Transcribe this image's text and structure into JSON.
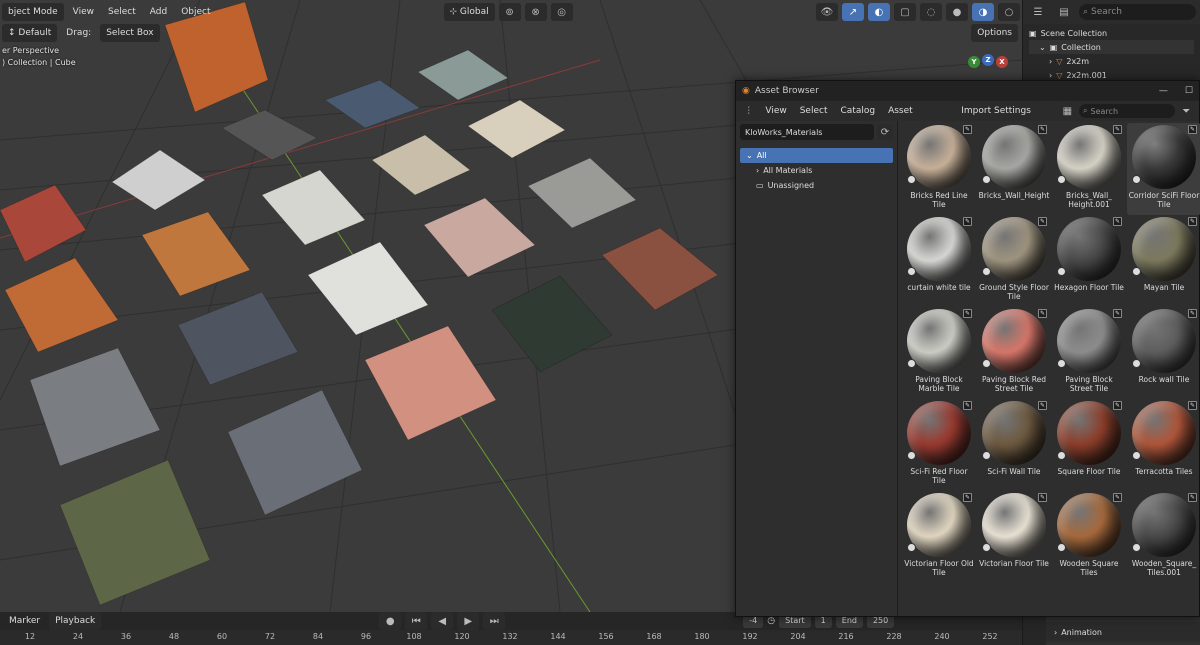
{
  "header": {
    "mode": "bject Mode",
    "menus": [
      "View",
      "Select",
      "Add",
      "Object"
    ],
    "transform_orientation": "Global",
    "orientation_preset": "Default",
    "drag_label": "Drag:",
    "drag_value": "Select Box",
    "options": "Options"
  },
  "viewport": {
    "perspective_label": "er Perspective",
    "collection_label": ") Collection | Cube"
  },
  "gizmo": {
    "x": "X",
    "y": "Y",
    "z": "Z"
  },
  "outliner": {
    "search_placeholder": "Search",
    "scene_collection": "Scene Collection",
    "collection": "Collection",
    "items": [
      "2x2m",
      "2x2m.001"
    ]
  },
  "properties": {
    "animation": "Animation"
  },
  "timeline": {
    "marker": "Marker",
    "playback": "Playback",
    "current_frame": "-4",
    "start_label": "Start",
    "start_value": "1",
    "end_label": "End",
    "end_value": "250",
    "ticks": [
      "12",
      "24",
      "36",
      "48",
      "60",
      "72",
      "84",
      "96",
      "108",
      "120",
      "132",
      "144",
      "156",
      "168",
      "180",
      "192",
      "204",
      "216",
      "228",
      "240",
      "252"
    ]
  },
  "asset_browser": {
    "title": "Asset Browser",
    "menus": [
      "View",
      "Select",
      "Catalog",
      "Asset"
    ],
    "import_settings": "Import Settings",
    "search_placeholder": "Search",
    "library": "KloWorks_Materials",
    "catalogs": {
      "all": "All",
      "all_materials": "All Materials",
      "unassigned": "Unassigned"
    },
    "assets": [
      {
        "name": "Bricks Red Line Tile",
        "color": "#c9b29a"
      },
      {
        "name": "Bricks_Wall_Height",
        "color": "#a8a8a4"
      },
      {
        "name": "Bricks_Wall_ Height.001",
        "color": "#d8d4c8"
      },
      {
        "name": "Corridor SciFi Floor Tile",
        "color": "#3a3a3a"
      },
      {
        "name": "curtain white tile",
        "color": "#d9d9d6"
      },
      {
        "name": "Ground Style Floor Tile",
        "color": "#a09580"
      },
      {
        "name": "Hexagon  Floor Tile",
        "color": "#4a4a4a"
      },
      {
        "name": "Mayan Tile",
        "color": "#7d7a5e"
      },
      {
        "name": "Paving Block Marble Tile",
        "color": "#cfcfc8"
      },
      {
        "name": "Paving Block Red Street Tile",
        "color": "#d9776a"
      },
      {
        "name": "Paving Block Street Tile",
        "color": "#8e8e8e"
      },
      {
        "name": "Rock wall Tile",
        "color": "#5e5e5e"
      },
      {
        "name": "Sci-Fi Red Floor Tile",
        "color": "#9a3a30"
      },
      {
        "name": "Sci-Fi Wall Tile",
        "color": "#6e5a40"
      },
      {
        "name": "Square Floor Tile",
        "color": "#8d3e2a"
      },
      {
        "name": "Terracotta Tiles",
        "color": "#b0563a"
      },
      {
        "name": "Victorian Floor Old Tile",
        "color": "#e3d8c2"
      },
      {
        "name": "Victorian Floor Tile",
        "color": "#ebe4d6"
      },
      {
        "name": "Wooden Square Tiles",
        "color": "#a86a3c"
      },
      {
        "name": "Wooden_Square_ Tiles.001",
        "color": "#4a4a4a"
      }
    ]
  }
}
